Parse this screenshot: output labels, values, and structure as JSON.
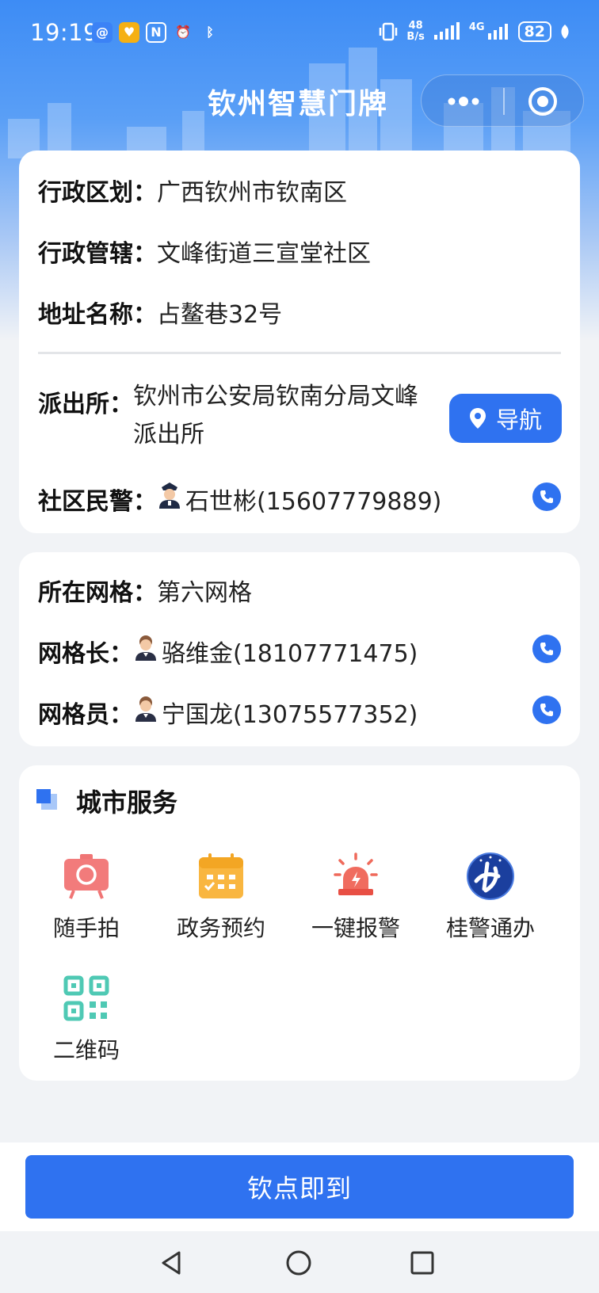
{
  "status_bar": {
    "time": "19:19",
    "net_speed_value": "48",
    "net_speed_unit": "B/s",
    "network": "4G",
    "battery": "82"
  },
  "header": {
    "title": "钦州智慧门牌"
  },
  "address_card": {
    "district_label": "行政区划：",
    "district_value": "广西钦州市钦南区",
    "jurisdiction_label": "行政管辖：",
    "jurisdiction_value": "文峰街道三宣堂社区",
    "address_label": "地址名称：",
    "address_value": "占鳌巷32号",
    "police_station_label": "派出所：",
    "police_station_line1": "钦州市公安局钦南分局文峰",
    "police_station_line2": "派出所",
    "nav_button": "导航",
    "officer_label": "社区民警：",
    "officer_value": "石世彬(15607779889)"
  },
  "grid_card": {
    "grid_label": "所在网格：",
    "grid_value": "第六网格",
    "leader_label": "网格长：",
    "leader_value": "骆维金(18107771475)",
    "member_label": "网格员：",
    "member_value": "宁国龙(13075577352)"
  },
  "services": {
    "title": "城市服务",
    "items": [
      {
        "label": "随手拍",
        "icon": "camera-icon"
      },
      {
        "label": "政务预约",
        "icon": "calendar-icon"
      },
      {
        "label": "一键报警",
        "icon": "alarm-icon"
      },
      {
        "label": "桂警通办",
        "icon": "gui-police-logo"
      },
      {
        "label": "二维码",
        "icon": "qrcode-icon"
      }
    ]
  },
  "bottom": {
    "checkin_button": "钦点即到"
  },
  "colors": {
    "primary": "#2f72f0",
    "header_top": "#3d8cf5"
  }
}
